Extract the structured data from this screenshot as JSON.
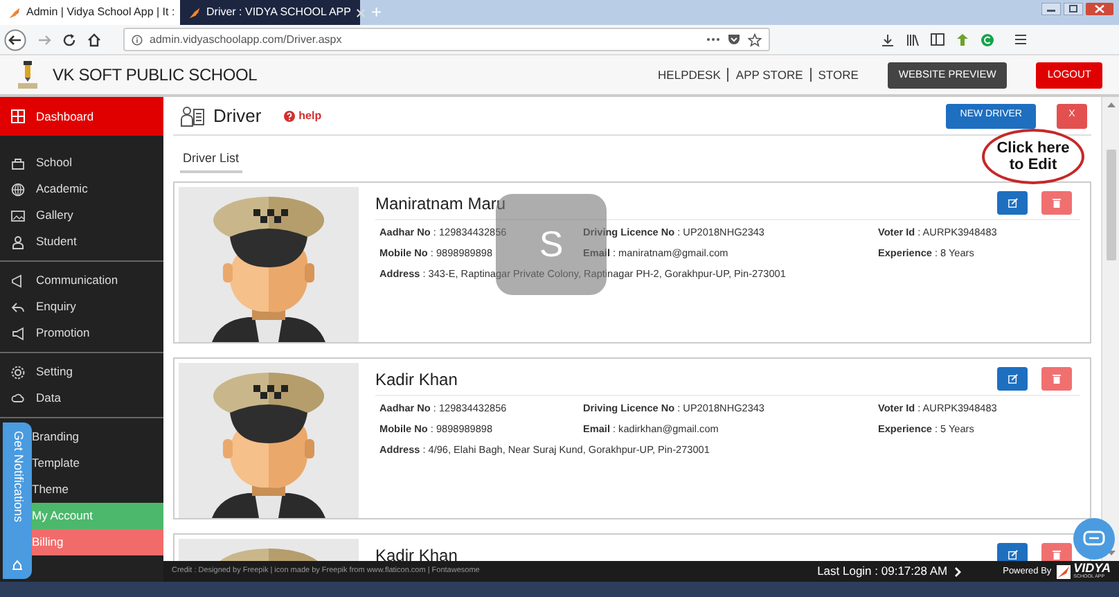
{
  "browser": {
    "tabs": [
      {
        "title": "Admin | Vidya School App | It :",
        "selected": false
      },
      {
        "title": "Driver : VIDYA SCHOOL APP",
        "selected": true
      }
    ],
    "new_tab": "+",
    "url": "admin.vidyaschoolapp.com/Driver.aspx"
  },
  "header": {
    "school_name": "VK SOFT PUBLIC SCHOOL",
    "links": [
      "HELPDESK",
      "APP STORE",
      "STORE"
    ],
    "preview_button": "WEBSITE PREVIEW",
    "logout_button": "LOGOUT"
  },
  "sidebar": {
    "groups": [
      [
        {
          "label": "Dashboard",
          "selected": true
        }
      ],
      [
        {
          "label": "School",
          "selected": false
        },
        {
          "label": "Academic",
          "selected": false
        },
        {
          "label": "Gallery",
          "selected": false
        },
        {
          "label": "Student",
          "selected": false
        }
      ],
      [
        {
          "label": "Communication",
          "selected": false
        },
        {
          "label": "Enquiry",
          "selected": false
        },
        {
          "label": "Promotion",
          "selected": false
        }
      ],
      [
        {
          "label": "Setting",
          "selected": false
        },
        {
          "label": "Data",
          "selected": false
        }
      ],
      [
        {
          "label": "Branding",
          "selected": false
        },
        {
          "label": "Template",
          "selected": false
        },
        {
          "label": "Theme",
          "selected": false
        },
        {
          "label": "My Account",
          "selected": false,
          "color": "#4cb86b"
        },
        {
          "label": "Billing",
          "selected": false,
          "color": "#f26b6b"
        }
      ]
    ]
  },
  "page": {
    "title": "Driver",
    "help": "help",
    "new_button": "NEW DRIVER",
    "close_button": "X",
    "section_tab": "Driver List"
  },
  "drivers": [
    {
      "name": "Maniratnam Maru",
      "fields": [
        "**Aadhar No** : 129834432856",
        "**Driving Licence No** : UP2018NHG2343",
        "**Voter Id** : AURPK3948483",
        "**Mobile No** : 9898989898",
        "**Email** : maniratnam@gmail.com",
        "**Experience** : 8 Years",
        "**Address** : 343-E, Raptinagar Private Colony, Raptinagar PH-2, Gorakhpur-UP, Pin-273001"
      ]
    },
    {
      "name": "Kadir Khan",
      "fields": [
        "**Aadhar No** : 129834432856",
        "**Driving Licence No** : UP2018NHG2343",
        "**Voter Id** : AURPK3948483",
        "**Mobile No** : 9898989898",
        "**Email** : kadirkhan@gmail.com",
        "**Experience** : 5 Years",
        "**Address** : 4/96, Elahi Bagh, Near Suraj Kund, Gorakhpur-UP, Pin-273001"
      ]
    },
    {
      "name": "Kadir Khan"
    }
  ],
  "annotation": "Click here to Edit",
  "overlay_badge": "S",
  "notifications_tab": "Get Notifications",
  "footer": {
    "credit": "Credit : Designed by Freepik | icon made by Freepik from www.flaticon.com | Fontawesome",
    "last_login": "Last Login : 09:17:28 AM",
    "powered_by": "Powered By",
    "logo": "VIDYA",
    "logo_sub": "SCHOOL APP"
  }
}
